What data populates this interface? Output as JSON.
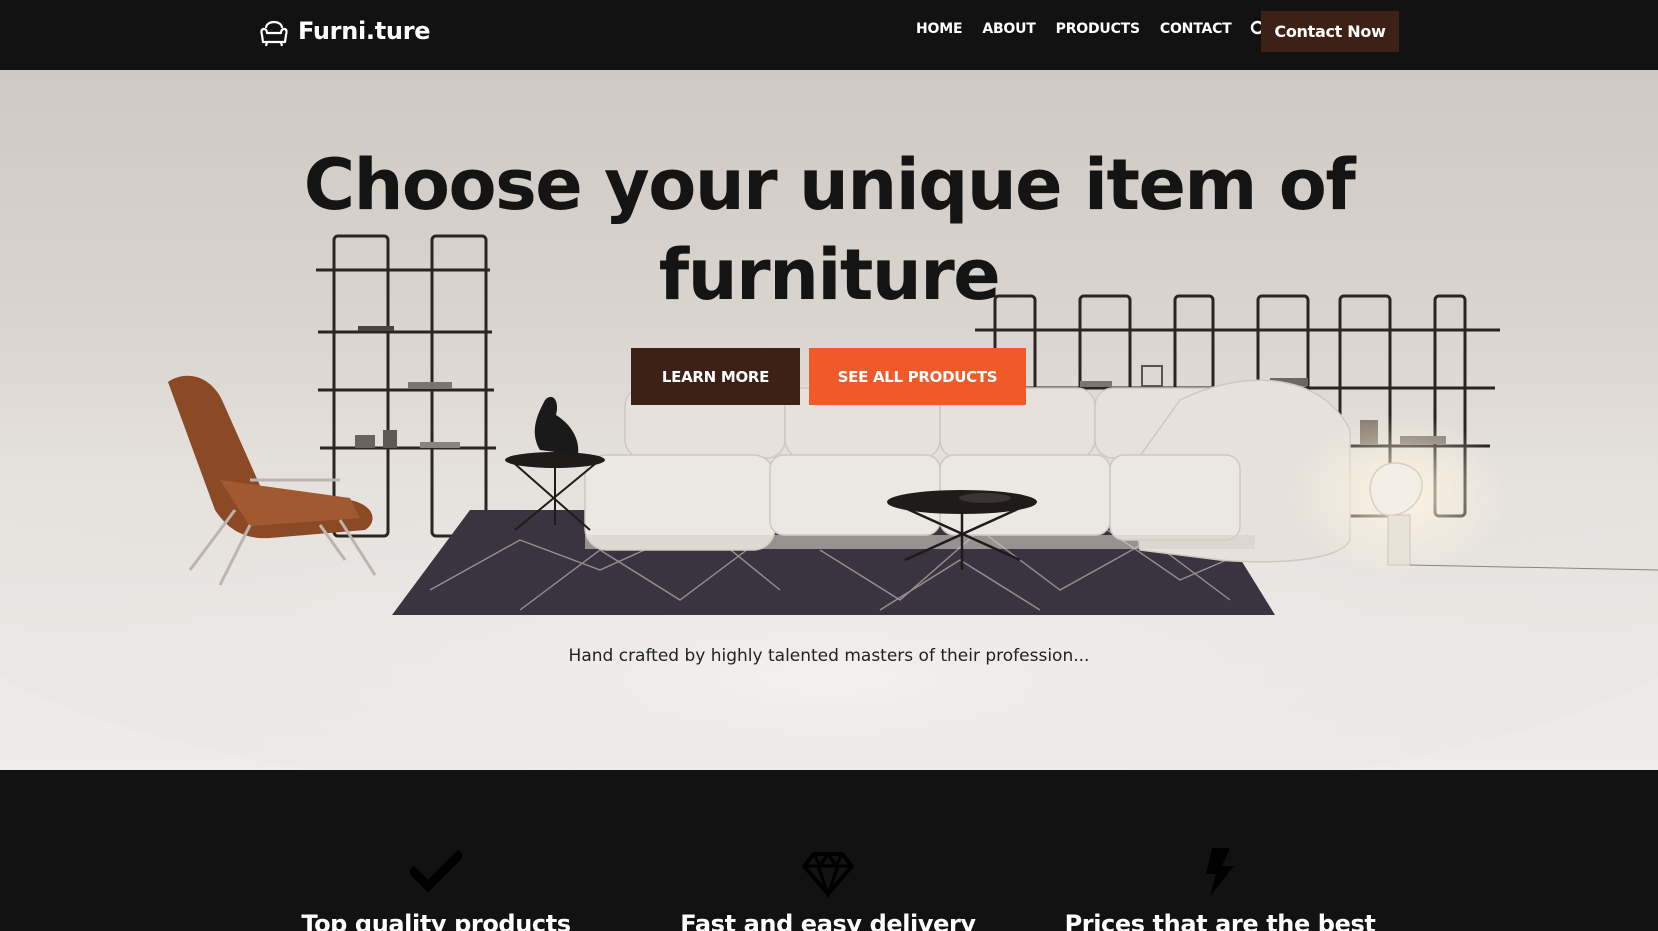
{
  "nav": {
    "brand": "Furni.ture",
    "links": [
      "HOME",
      "ABOUT",
      "PRODUCTS",
      "CONTACT"
    ],
    "contact_button": "Contact Now"
  },
  "hero": {
    "title": "Choose your unique item of furniture",
    "learn_more": "LEARN MORE",
    "see_all": "SEE ALL PRODUCTS",
    "subtitle": "Hand crafted by highly talented masters of their profession..."
  },
  "features": [
    {
      "icon": "check-icon",
      "title": "Top quality products"
    },
    {
      "icon": "diamond-icon",
      "title": "Fast and easy delivery"
    },
    {
      "icon": "bolt-icon",
      "title": "Prices that are the best"
    }
  ],
  "colors": {
    "background": "#121212",
    "brown": "#3e2116",
    "orange": "#f05a28",
    "text_dark": "#141414"
  }
}
